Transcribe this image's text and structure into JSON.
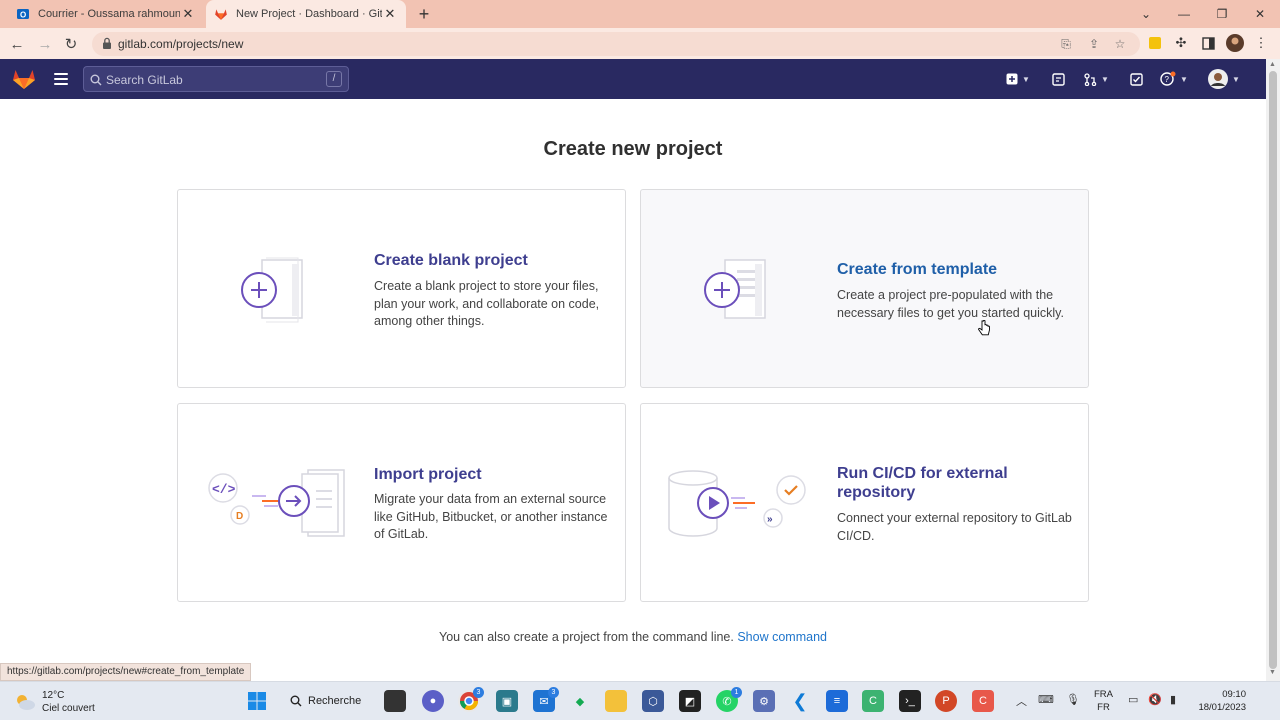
{
  "browser": {
    "tabs": [
      {
        "title": "Courrier - Oussama rahmouni - O",
        "icon": "outlook-icon",
        "active": false
      },
      {
        "title": "New Project · Dashboard · GitLab",
        "icon": "gitlab-icon",
        "active": true
      }
    ],
    "url": "gitlab.com/projects/new",
    "status_url": "https://gitlab.com/projects/new#create_from_template"
  },
  "gitlab_header": {
    "search_placeholder": "Search GitLab",
    "search_shortcut": "/"
  },
  "main": {
    "title": "Create new project",
    "cards": [
      {
        "title": "Create blank project",
        "desc": "Create a blank project to store your files, plan your work, and collaborate on code, among other things."
      },
      {
        "title": "Create from template",
        "desc": "Create a project pre-populated with the necessary files to get you started quickly."
      },
      {
        "title": "Import project",
        "desc": "Migrate your data from an external source like GitHub, Bitbucket, or another instance of GitLab."
      },
      {
        "title": "Run CI/CD for external repository",
        "desc": "Connect your external repository to GitLab CI/CD."
      }
    ],
    "command_line_text": "You can also create a project from the command line.",
    "show_command": "Show command"
  },
  "taskbar": {
    "weather_temp": "12°C",
    "weather_desc": "Ciel couvert",
    "search_label": "Recherche",
    "badges": {
      "chrome": "3",
      "mail": "3",
      "whatsapp": "1"
    },
    "lang_top": "FRA",
    "lang_bottom": "FR",
    "time": "09:10",
    "date": "18/01/2023"
  },
  "colors": {
    "gitlab_nav": "#292961",
    "card_title": "#3e3e8f",
    "link": "#1f75cb",
    "browser_frame": "#f2c3b3"
  }
}
